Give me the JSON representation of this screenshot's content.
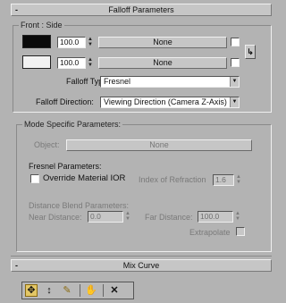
{
  "falloff_rollout": {
    "sign": "-",
    "title": "Falloff Parameters"
  },
  "front_side": {
    "group_title": "Front : Side",
    "color1_swatch": "#0a0a0a",
    "color2_swatch": "#f2f2f2",
    "amount1_value": "100.0",
    "amount2_value": "100.0",
    "map1_label": "None",
    "map2_label": "None",
    "swap_icon": "swap-arrow-icon",
    "swap_glyph": "↳"
  },
  "falloff": {
    "type_label": "Falloff Type:",
    "type_value": "Fresnel",
    "direction_label": "Falloff Direction:",
    "direction_value": "Viewing Direction (Camera Z-Axis)"
  },
  "mode_specific": {
    "group_title": "Mode Specific Parameters:",
    "object_label": "Object:",
    "object_button": "None",
    "fresnel_label": "Fresnel Parameters:",
    "override_label": "Override Material IOR",
    "ior_label": "Index of Refraction",
    "ior_value": "1.6",
    "distance_blend_label": "Distance Blend Parameters:",
    "near_label": "Near Distance:",
    "near_value": "0.0",
    "far_label": "Far Distance:",
    "far_value": "100.0",
    "extrapolate_label": "Extrapolate"
  },
  "mix_curve_rollout": {
    "sign": "-",
    "title": "Mix Curve"
  },
  "toolbar": {
    "move_icon": "move-icon",
    "scale_icon": "scale-icon",
    "insert_point_icon": "insert-point-icon",
    "pan_icon": "pan-hand-icon",
    "delete_icon": "delete-icon",
    "move_glyph": "✥",
    "scale_glyph": "↕",
    "insert_glyph": "✎",
    "pan_glyph": "✋",
    "delete_glyph": "✕"
  }
}
